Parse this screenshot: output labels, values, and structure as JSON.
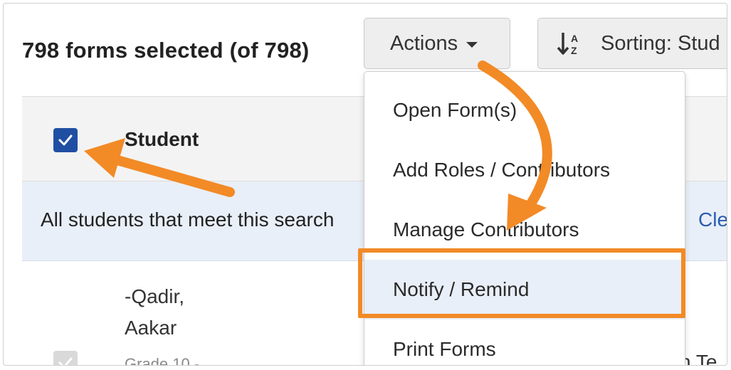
{
  "header": {
    "selection_summary": "798 forms selected (of 798)"
  },
  "toolbar": {
    "actions_label": "Actions",
    "sorting_label": "Sorting: Stud"
  },
  "actions_menu": {
    "items": [
      {
        "label": "Open Form(s)"
      },
      {
        "label": "Add Roles / Contributors"
      },
      {
        "label": "Manage Contributors"
      },
      {
        "label": "Notify / Remind"
      },
      {
        "label": "Print Forms"
      }
    ],
    "highlighted_index": 3
  },
  "table": {
    "header": {
      "student_label": "Student",
      "select_all_checked": true
    },
    "banner": {
      "text": "All students that meet this search",
      "clear_label": "Clear"
    },
    "rows": [
      {
        "name_line1": "-Qadir,",
        "name_line2": "Aakar",
        "grade": "Grade 10 -",
        "extra": "n Te"
      }
    ]
  },
  "colors": {
    "accent_orange": "#f28a26",
    "checkbox_blue": "#1f4fa3",
    "link_blue": "#2a5db0",
    "highlight_bg": "#e9eff8"
  },
  "icons": {
    "sort": "sort-alpha-down-icon",
    "caret": "caret-down-icon",
    "check": "checkmark-icon"
  }
}
